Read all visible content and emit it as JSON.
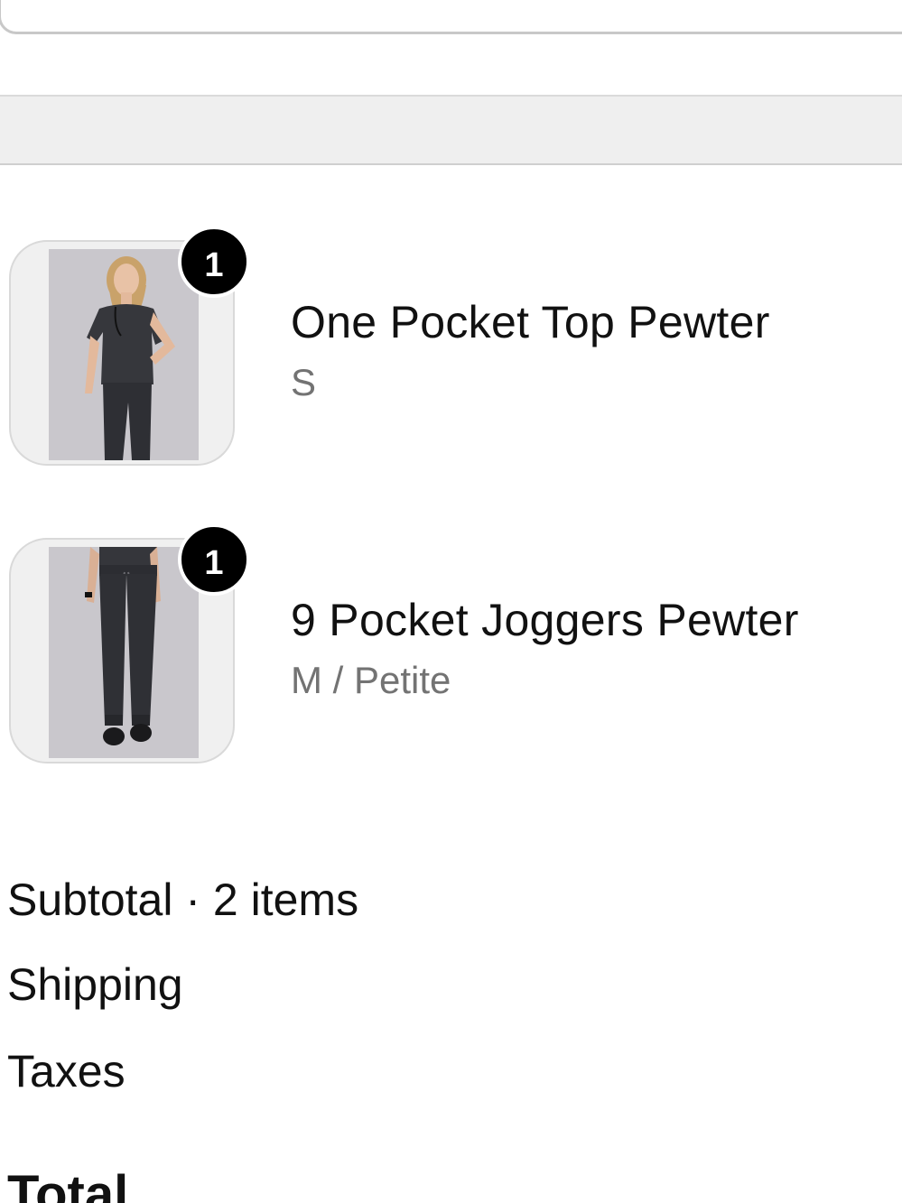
{
  "cart": {
    "items": [
      {
        "quantity": "1",
        "title": "One Pocket Top Pewter",
        "variant": "S",
        "image_icon": "scrub-top-product-photo"
      },
      {
        "quantity": "1",
        "title": "9 Pocket Joggers Pewter",
        "variant": "M / Petite",
        "image_icon": "scrub-joggers-product-photo"
      }
    ]
  },
  "summary": {
    "subtotal_label": "Subtotal · 2 items",
    "shipping_label": "Shipping",
    "taxes_label": "Taxes",
    "total_label": "Total"
  },
  "colors": {
    "badge": "#000000",
    "variant_text": "#737373",
    "band": "#efefef"
  }
}
